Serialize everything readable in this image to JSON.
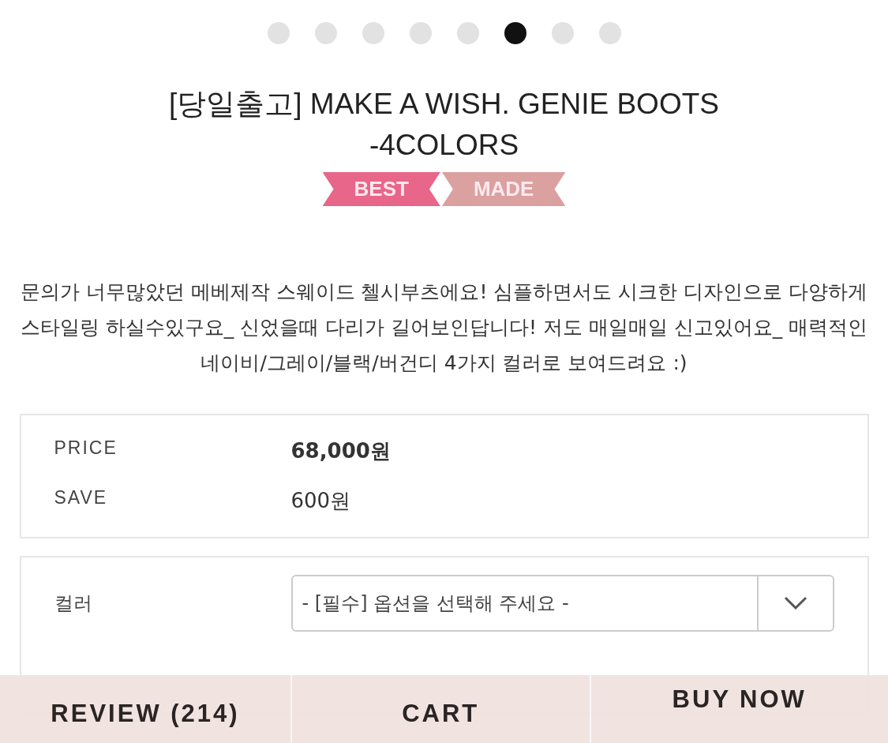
{
  "carousel": {
    "dots": [
      {
        "selected": false
      },
      {
        "selected": false
      },
      {
        "selected": false
      },
      {
        "selected": false
      },
      {
        "selected": false
      },
      {
        "selected": true
      },
      {
        "selected": false
      },
      {
        "selected": false
      }
    ]
  },
  "product": {
    "title": "[당일출고] MAKE A WISH. GENIE BOOTS -4COLORS",
    "badges": [
      {
        "label": "BEST",
        "color": "#e8668a"
      },
      {
        "label": "MADE",
        "color": "#dba0a0"
      }
    ],
    "description": "문의가 너무많았던 메베제작 스웨이드 첼시부츠에요! 심플하면서도 시크한 디자인으로 다양하게 스타일링 하실수있구요_ 신었을때 다리가 길어보인답니다! 저도 매일매일 신고있어요_ 매력적인 네이비/그레이/블랙/버건디 4가지 컬러로 보여드려요 :)"
  },
  "price_table": [
    {
      "label": "PRICE",
      "value": "68,000원",
      "kind": "price"
    },
    {
      "label": "SAVE",
      "value": "600원",
      "kind": "save"
    }
  ],
  "options": [
    {
      "label": "컬러",
      "placeholder": "- [필수] 옵션을 선택해 주세요 -"
    }
  ],
  "bottom_bar": [
    "REVIEW (214)",
    "CART",
    "BUY NOW"
  ]
}
